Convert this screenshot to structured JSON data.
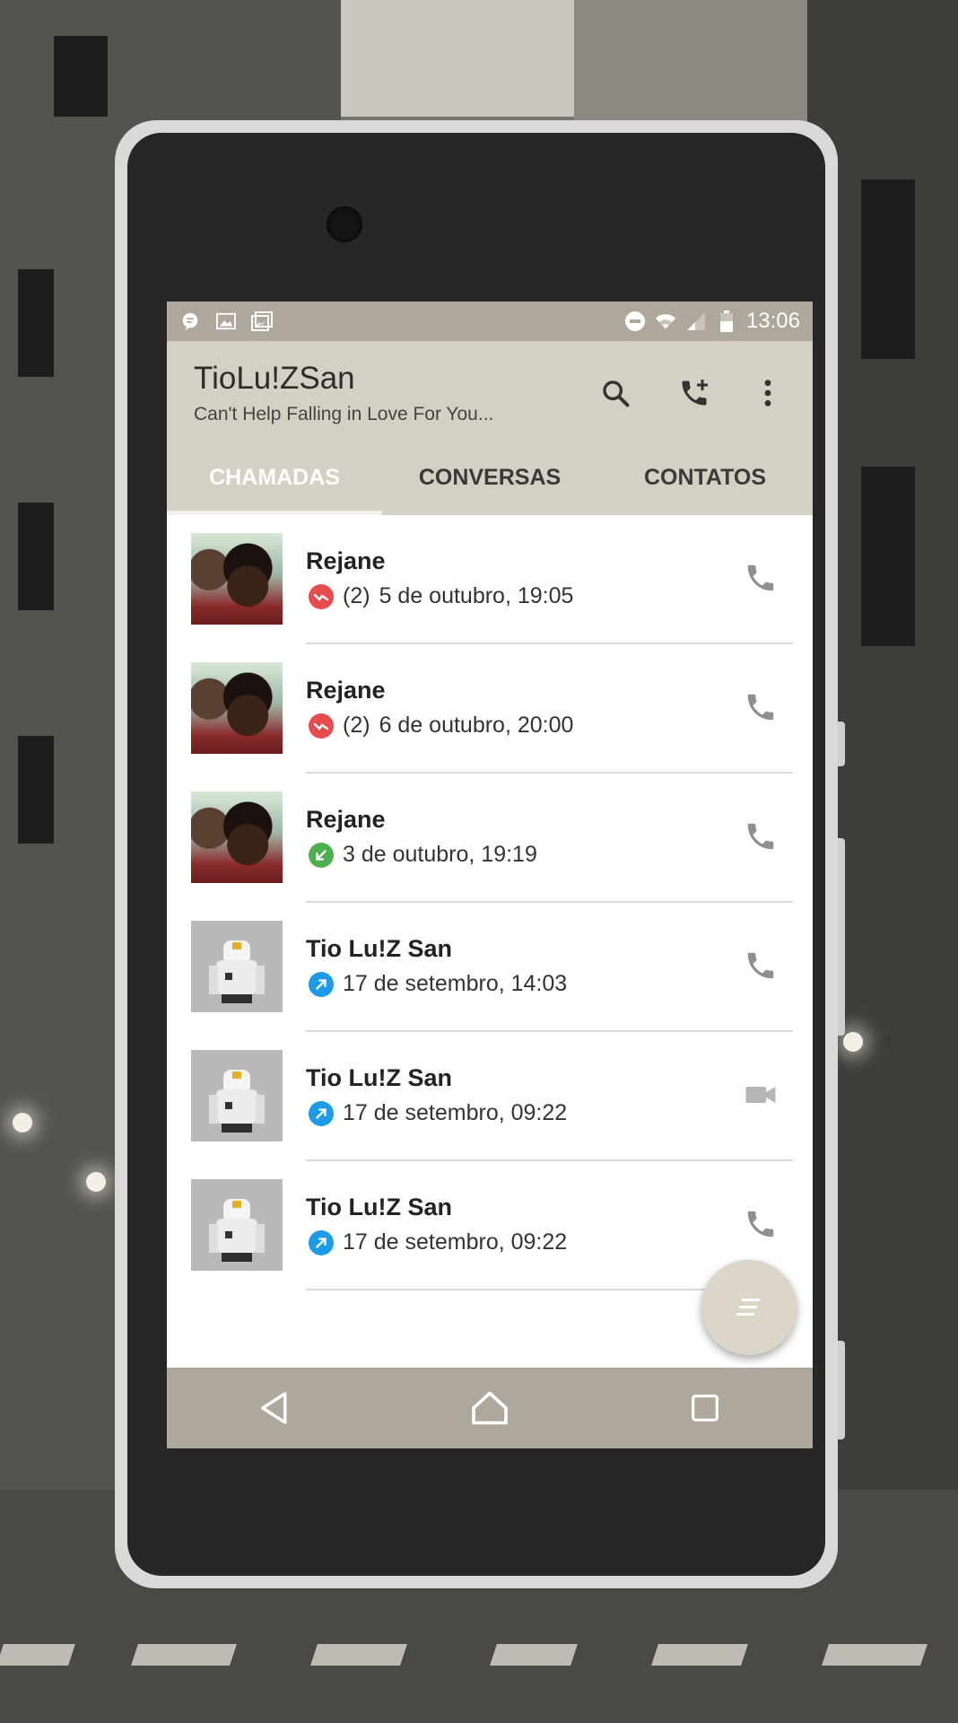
{
  "status_bar": {
    "time": "13:06",
    "icons": [
      "chat-bubble-icon",
      "image-icon",
      "gallery-icon",
      "do-not-disturb-icon",
      "wifi-icon",
      "signal-icon",
      "battery-icon"
    ]
  },
  "app_bar": {
    "title": "TioLu!ZSan",
    "subtitle": "Can't Help Falling in Love For You...",
    "actions": [
      "search-icon",
      "add-call-icon",
      "more-vert-icon"
    ]
  },
  "tabs": [
    {
      "label": "CHAMADAS",
      "active": true
    },
    {
      "label": "CONVERSAS",
      "active": false
    },
    {
      "label": "CONTATOS",
      "active": false
    }
  ],
  "calls": [
    {
      "name": "Rejane",
      "count": "(2)",
      "when": "5 de outubro, 19:05",
      "direction": "missed",
      "action": "phone-icon"
    },
    {
      "name": "Rejane",
      "count": "(2)",
      "when": "6 de outubro, 20:00",
      "direction": "missed",
      "action": "phone-icon"
    },
    {
      "name": "Rejane",
      "count": "",
      "when": "3 de outubro, 19:19",
      "direction": "incoming",
      "action": "phone-icon"
    },
    {
      "name": "Tio Lu!Z San",
      "count": "",
      "when": "17 de setembro, 14:03",
      "direction": "outgoing",
      "action": "phone-icon"
    },
    {
      "name": "Tio Lu!Z San",
      "count": "",
      "when": "17 de setembro, 09:22",
      "direction": "outgoing",
      "action": "videocam-icon"
    },
    {
      "name": "Tio Lu!Z San",
      "count": "",
      "when": "17 de setembro, 09:22",
      "direction": "outgoing",
      "action": "phone-icon"
    }
  ],
  "colors": {
    "missed": "#e84b4b",
    "incoming": "#4caf50",
    "outgoing": "#1e9be8",
    "app_bar": "#d5d0c4",
    "status_bar": "#aea89c"
  },
  "fab": {
    "icon": "dialpad-icon"
  },
  "nav": [
    "back-icon",
    "home-icon",
    "recents-icon"
  ]
}
